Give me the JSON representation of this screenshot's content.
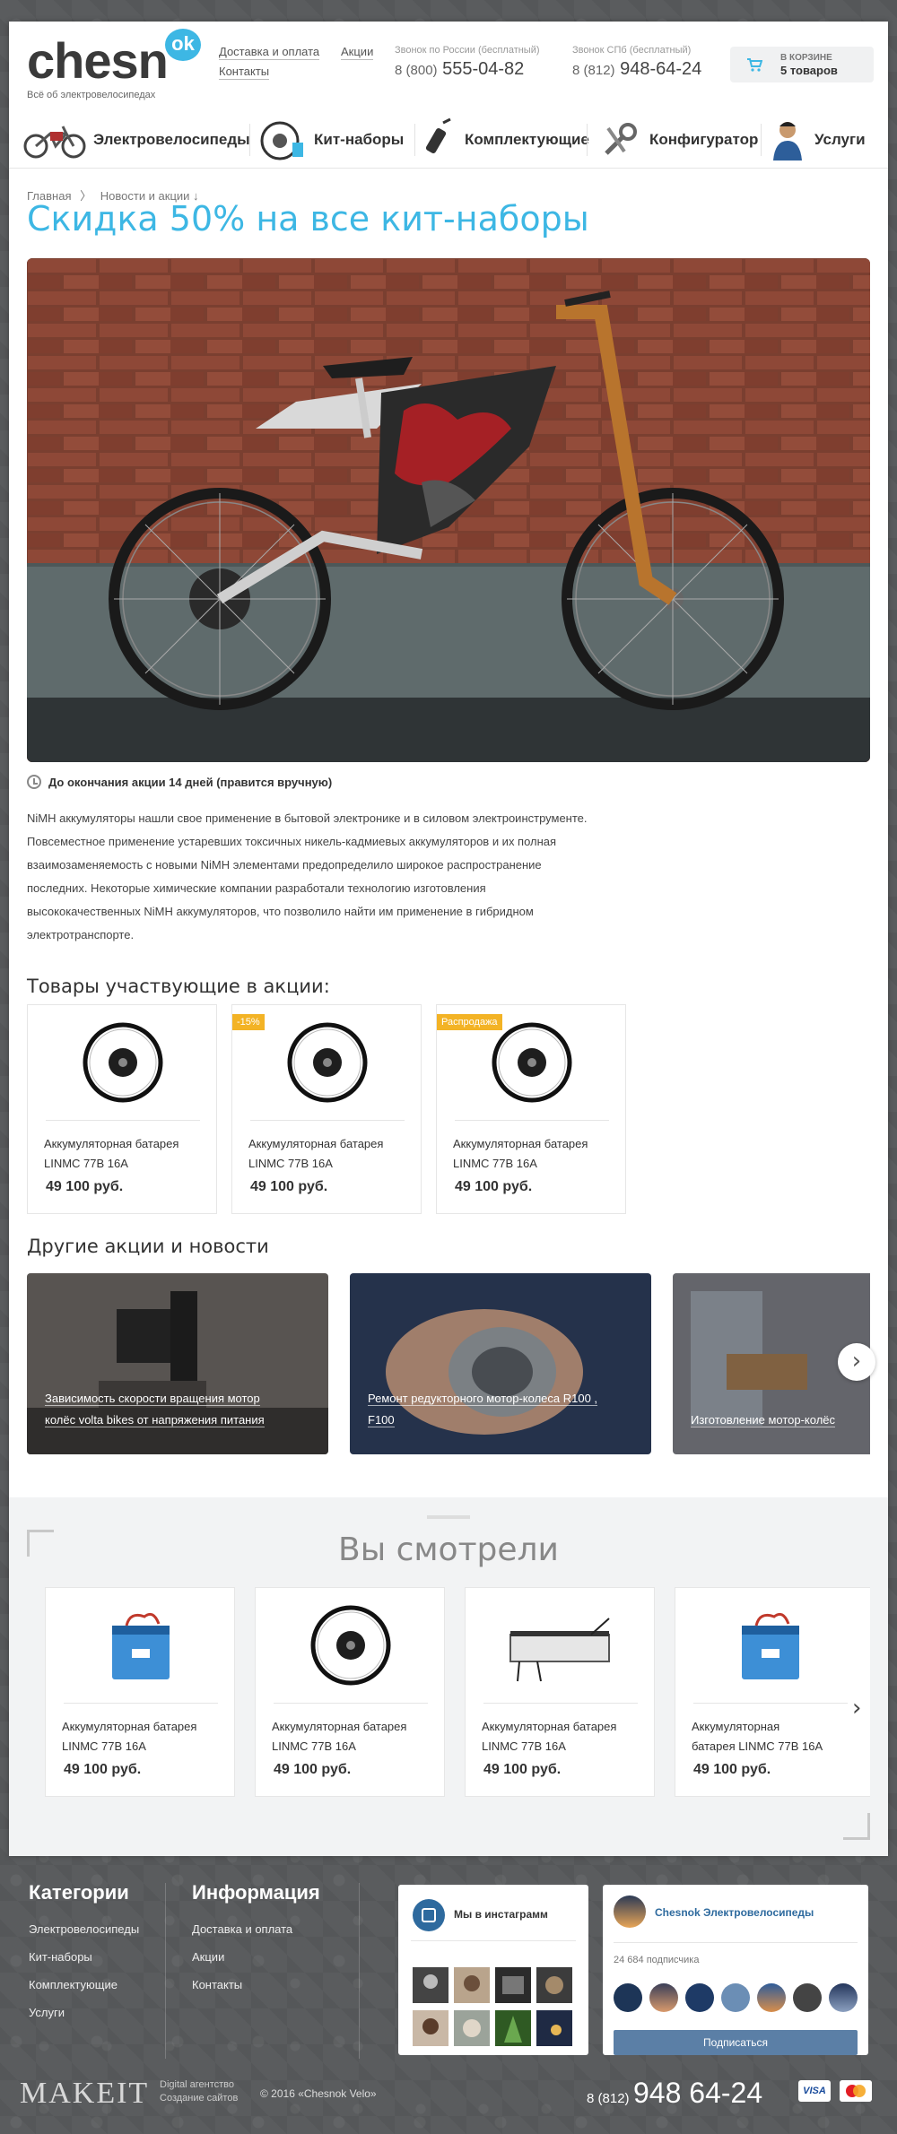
{
  "header": {
    "logo": "chesn",
    "logo_badge": "ok",
    "tagline": "Всё об электровелосипедах",
    "links": [
      "Доставка и оплата",
      "Акции",
      "Контакты"
    ],
    "phone_russia_label": "Звонок по России (бесплатный)",
    "phone_russia_prefix": "8 (800)",
    "phone_russia_number": "555-04-82",
    "phone_spb_label": "Звонок СПб (бесплатный)",
    "phone_spb_prefix": "8 (812)",
    "phone_spb_number": "948-64-24",
    "cart_label": "В КОРЗИНЕ",
    "cart_count": "5 товаров"
  },
  "nav": [
    "Электровелосипеды",
    "Кит-наборы",
    "Комплектующие",
    "Конфигуратор",
    "Услуги"
  ],
  "breadcrumb": [
    "Главная",
    "〉",
    "Новости и акции ↓"
  ],
  "page_title": "Скидка 50% на все кит-наборы",
  "timer": "До окончания акции 14 дней (правится вручную)",
  "description": [
    "NiMH аккумуляторы нашли свое применение в бытовой электронике и в силовом электроинструменте.",
    "Повсеместное применение устаревших токсичных никель-кадмиевых аккумуляторов и их полная",
    "взаимозаменяемость с новыми NiMH элементами предопределило широкое распространение",
    "последних. Некоторые химические компании разработали технологию изготовления",
    "высококачественных NiMH аккумуляторов, что позволило найти им применение в гибридном",
    "электротранспорте."
  ],
  "promo_heading": "Товары участвующие в акции:",
  "promo_products": [
    {
      "badge": "",
      "name1": "Аккумуляторная батарея",
      "name2": "LINMC 77В 16А",
      "price": "49 100 руб."
    },
    {
      "badge": "-15%",
      "name1": "Аккумуляторная батарея",
      "name2": "LINMC 77В 16А",
      "price": "49 100 руб."
    },
    {
      "badge": "Распродажа",
      "name1": "Аккумуляторная батарея",
      "name2": "LINMC 77В 16А",
      "price": "49 100 руб."
    }
  ],
  "news_heading": "Другие акции и новости",
  "news": [
    {
      "line1": "Зависимость скорости вращения мотор",
      "line2": "колёс volta bikes от напряжения питания"
    },
    {
      "line1": "Ремонт редукторного мотор-колеса R100 ,",
      "line2": "F100"
    },
    {
      "line1": "Изготовление мотор-колёс",
      "line2": ""
    }
  ],
  "viewed_heading": "Вы смотрели",
  "viewed_products": [
    {
      "name1": "Аккумуляторная батарея",
      "name2": "LINMC 77В 16А",
      "price": "49 100 руб."
    },
    {
      "name1": "Аккумуляторная батарея",
      "name2": "LINMC 77В 16А",
      "price": "49 100 руб."
    },
    {
      "name1": "Аккумуляторная батарея",
      "name2": "LINMC 77В 16А",
      "price": "49 100 руб."
    },
    {
      "name1": "Аккумуляторная",
      "name2": "батарея LINMC 77В 16А",
      "price": "49 100 руб."
    }
  ],
  "footer": {
    "categories_title": "Категории",
    "categories": [
      "Электровелосипеды",
      "Кит-наборы",
      "Комплектующие",
      "Услуги"
    ],
    "info_title": "Информация",
    "info": [
      "Доставка и оплата",
      "Акции",
      "Контакты"
    ],
    "instagram_title": "Мы в инстаграмм",
    "vk_name": "Chesnok Электровелосипеды",
    "vk_subscribers": "24 684 подписчика",
    "vk_button": "Подписаться",
    "agency": "MAKEIT",
    "agency_line1": "Digital агентство",
    "agency_line2": "Создание сайтов",
    "copyright": "© 2016 «Chesnok Velo»",
    "phone_prefix": "8 (812)",
    "phone_number": "948 64-24",
    "card_visa": "VISA"
  }
}
